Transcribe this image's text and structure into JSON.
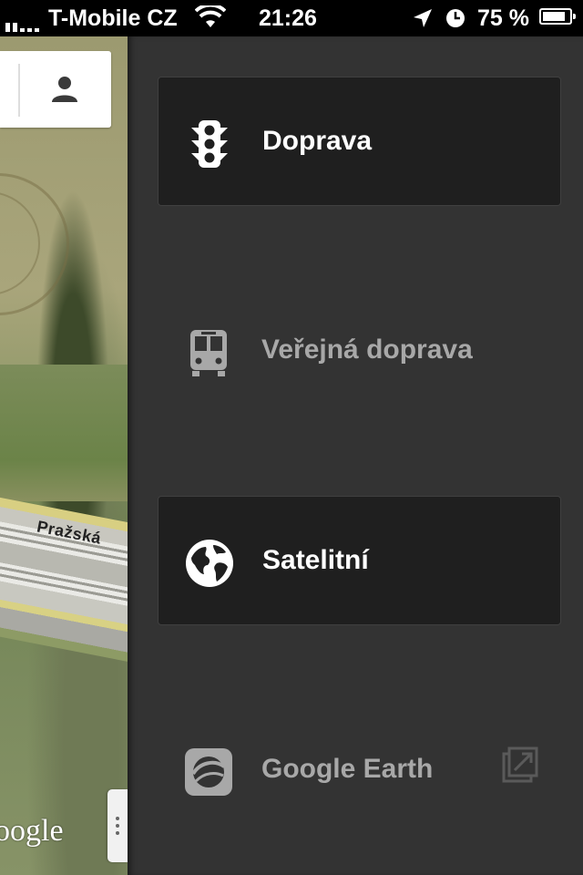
{
  "status_bar": {
    "carrier": "T-Mobile CZ",
    "time": "21:26",
    "battery_percent": "75 %"
  },
  "map": {
    "street_label": "Pražská",
    "logo_text": "oogle"
  },
  "menu": {
    "items": [
      {
        "label": "Doprava",
        "icon": "traffic-light-icon",
        "state": "active"
      },
      {
        "label": "Veřejná doprava",
        "icon": "train-icon",
        "state": "inactive"
      },
      {
        "label": "Satelitní",
        "icon": "globe-icon",
        "state": "active"
      },
      {
        "label": "Google Earth",
        "icon": "google-earth-icon",
        "state": "inactive",
        "trailing_icon": "external-link-icon"
      }
    ]
  },
  "colors": {
    "panel_bg": "#333333",
    "active_item_bg": "#1f1f1f",
    "active_text": "#ffffff",
    "muted_text": "#a8a8a8"
  }
}
